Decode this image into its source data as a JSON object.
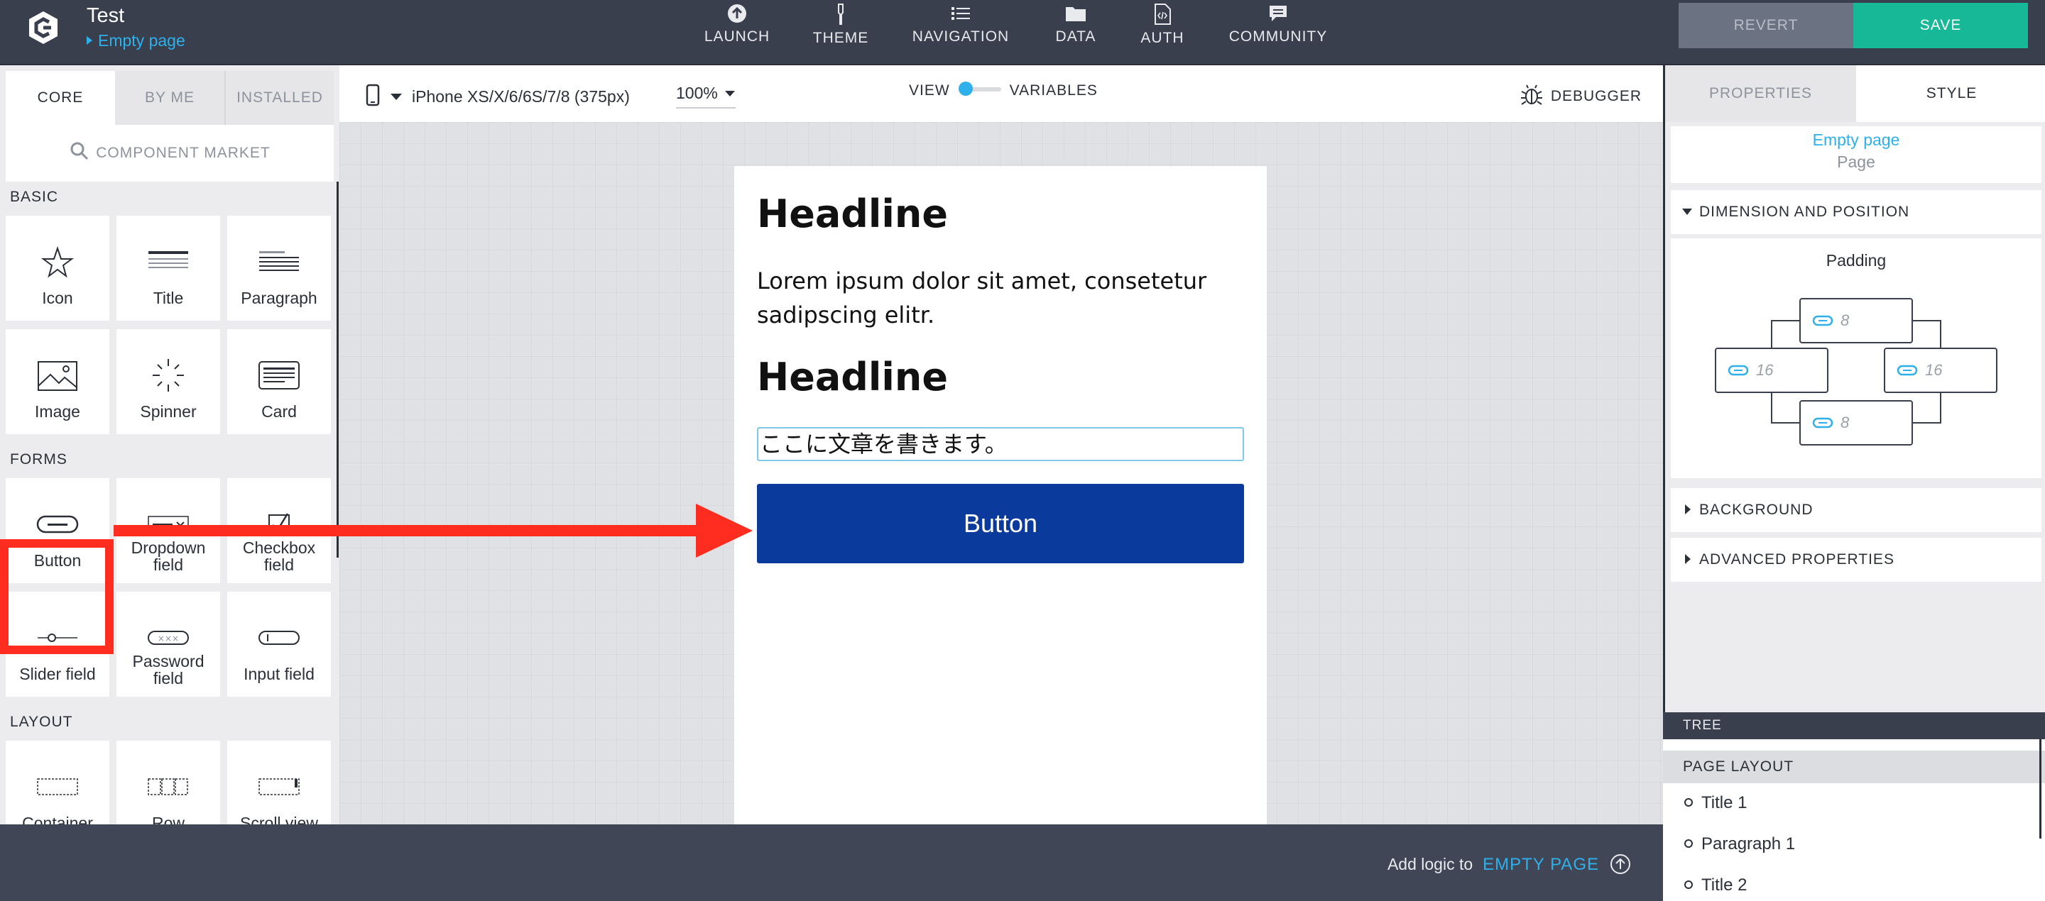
{
  "header": {
    "app_title": "Test",
    "page_link": "Empty page",
    "nav": [
      {
        "label": "LAUNCH",
        "icon": "launch-icon"
      },
      {
        "label": "THEME",
        "icon": "theme-icon"
      },
      {
        "label": "NAVIGATION",
        "icon": "navigation-icon"
      },
      {
        "label": "DATA",
        "icon": "data-folder-icon"
      },
      {
        "label": "AUTH",
        "icon": "auth-file-icon"
      },
      {
        "label": "COMMUNITY",
        "icon": "community-chat-icon"
      }
    ],
    "revert_label": "REVERT",
    "save_label": "SAVE"
  },
  "left_panel": {
    "tabs": [
      "CORE",
      "BY ME",
      "INSTALLED"
    ],
    "active_tab": "CORE",
    "market_label": "COMPONENT MARKET",
    "sections": {
      "basic": "BASIC",
      "forms": "FORMS",
      "layout": "LAYOUT"
    },
    "basic_items": [
      "Icon",
      "Title",
      "Paragraph",
      "Image",
      "Spinner",
      "Card"
    ],
    "forms_items": [
      "Button",
      "Dropdown field",
      "Checkbox field",
      "Slider field",
      "Password field",
      "Input field"
    ],
    "layout_items": [
      "Container",
      "Row",
      "Scroll view"
    ]
  },
  "toolbar": {
    "device": "iPhone XS/X/6/6S/7/8 (375px)",
    "zoom": "100%",
    "view_label": "VIEW",
    "variables_label": "VARIABLES",
    "debugger_label": "DEBUGGER"
  },
  "phone": {
    "headline1": "Headline",
    "paragraph": "Lorem ipsum dolor sit amet, consetetur sadipscing elitr.",
    "headline2": "Headline",
    "text_input": "ここに文章を書きます。",
    "button_label": "Button"
  },
  "bottom": {
    "logic_text": "Add logic to",
    "logic_link": "EMPTY PAGE"
  },
  "right_panel": {
    "tabs": [
      "PROPERTIES",
      "STYLE"
    ],
    "active_tab": "STYLE",
    "page_name": "Empty page",
    "page_type": "Page",
    "dimension_label": "DIMENSION AND POSITION",
    "padding_label": "Padding",
    "padding": {
      "top": "8",
      "left": "16",
      "right": "16",
      "bottom": "8"
    },
    "background_label": "BACKGROUND",
    "advanced_label": "ADVANCED PROPERTIES"
  },
  "tree": {
    "label": "TREE",
    "section": "PAGE LAYOUT",
    "items": [
      "Title 1",
      "Paragraph 1",
      "Title 2"
    ]
  },
  "colors": {
    "topbar": "#3a3f4e",
    "accent": "#2fb0ea",
    "save": "#17b897",
    "button": "#0a3b9c",
    "annotation": "#ff2d1f"
  }
}
